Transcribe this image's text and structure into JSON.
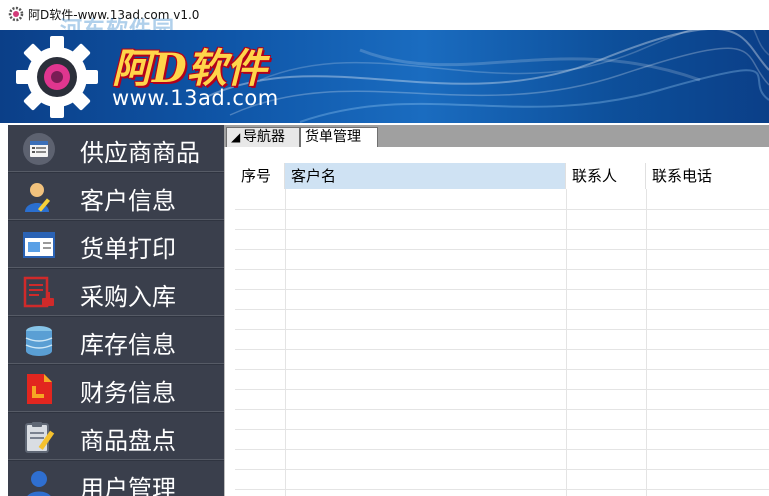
{
  "window": {
    "title": "阿D软件-www.13ad.com v1.0",
    "watermark": "河东软件园"
  },
  "banner": {
    "brand": "阿D软件",
    "url": "www.13ad.com"
  },
  "sidebar": {
    "items": [
      {
        "label": "供应商商品",
        "icon": "list-icon"
      },
      {
        "label": "客户信息",
        "icon": "user-edit-icon"
      },
      {
        "label": "货单打印",
        "icon": "print-document-icon"
      },
      {
        "label": "采购入库",
        "icon": "stamp-document-icon"
      },
      {
        "label": "库存信息",
        "icon": "database-icon"
      },
      {
        "label": "财务信息",
        "icon": "ledger-icon"
      },
      {
        "label": "商品盘点",
        "icon": "clipboard-pencil-icon"
      },
      {
        "label": "用户管理",
        "icon": "users-icon"
      }
    ]
  },
  "tabs": [
    {
      "label": "导航器",
      "active": false
    },
    {
      "label": "货单管理",
      "active": true
    }
  ],
  "grid": {
    "columns": [
      "序号",
      "客户名",
      "联系人",
      "联系电话"
    ],
    "selected_column": "客户名",
    "rows": []
  }
}
